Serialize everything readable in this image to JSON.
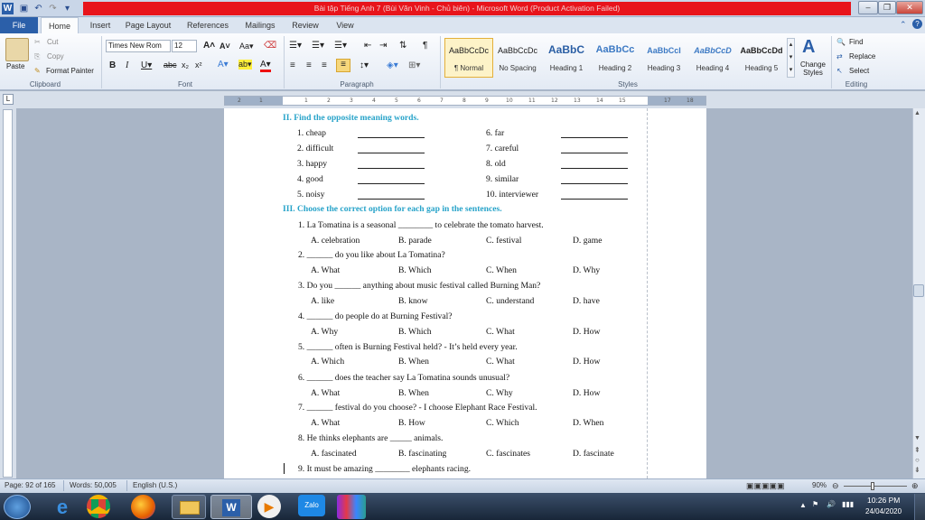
{
  "window": {
    "title": "Bài tập Tiếng Anh 7 (Bùi Văn Vinh - Chủ biên) - Microsoft Word (Product Activation Failed)"
  },
  "tabs": [
    "File",
    "Home",
    "Insert",
    "Page Layout",
    "References",
    "Mailings",
    "Review",
    "View"
  ],
  "clipboard": {
    "paste": "Paste",
    "cut": "Cut",
    "copy": "Copy",
    "format_painter": "Format Painter",
    "label": "Clipboard"
  },
  "font": {
    "name": "Times New Rom",
    "size": "12",
    "label": "Font"
  },
  "paragraph": {
    "label": "Paragraph"
  },
  "styles": {
    "label": "Styles",
    "items": [
      {
        "preview": "AaBbCcDc",
        "name": "¶ Normal"
      },
      {
        "preview": "AaBbCcDc",
        "name": "No Spacing"
      },
      {
        "preview": "AaBbC",
        "name": "Heading 1"
      },
      {
        "preview": "AaBbCc",
        "name": "Heading 2"
      },
      {
        "preview": "AaBbCcI",
        "name": "Heading 3"
      },
      {
        "preview": "AaBbCcD",
        "name": "Heading 4"
      },
      {
        "preview": "AaBbCcDd",
        "name": "Heading 5"
      }
    ],
    "change_styles": "Change Styles"
  },
  "editing": {
    "find": "Find",
    "replace": "Replace",
    "select": "Select",
    "label": "Editing"
  },
  "document": {
    "section2_title": "II.  Find the opposite meaning words.",
    "left_words": [
      "1. cheap",
      "2. difficult",
      "3. happy",
      "4. good",
      "5. noisy"
    ],
    "right_words": [
      "6. far",
      "7. careful",
      "8. old",
      "9. similar",
      "10. interviewer"
    ],
    "section3_title": "III. Choose the correct option for each gap in the sentences.",
    "questions": [
      {
        "q": "1.   La Tomatina is a seasonal ________ to celebrate the tomato harvest.",
        "a": "A. celebration",
        "b": "B. parade",
        "c": "C. festival",
        "d": "D. game"
      },
      {
        "q": "2.   ______ do you like about La Tomatina?",
        "a": "A. What",
        "b": "B. Which",
        "c": "C. When",
        "d": "D. Why"
      },
      {
        "q": "3.   Do you ______ anything about music festival called Burning Man?",
        "a": "A. like",
        "b": "B. know",
        "c": "C. understand",
        "d": "D. have"
      },
      {
        "q": "4.   ______ do people do at Burning Festival?",
        "a": "A. Why",
        "b": "B. Which",
        "c": "C. What",
        "d": "D. How"
      },
      {
        "q": "5.   ______ often is Burning Festival held? - It’s held every year.",
        "a": "A. Which",
        "b": "B. When",
        "c": "C. What",
        "d": "D. How"
      },
      {
        "q": "6.   ______ does the teacher say La Tomatina sounds unusual?",
        "a": "A. What",
        "b": "B. When",
        "c": "C. Why",
        "d": "D. How"
      },
      {
        "q": "7.   ______ festival do you choose? - I choose Elephant Race Festival.",
        "a": "A. What",
        "b": "B. How",
        "c": "C. Which",
        "d": "D. When"
      },
      {
        "q": "8.   He thinks elephants are _____ animals.",
        "a": "A. fascinated",
        "b": "B. fascinating",
        "c": "C. fascinates",
        "d": "D. fascinate"
      }
    ],
    "last_line": "9.   It must be amazing ________ elephants racing."
  },
  "status": {
    "page": "Page: 92 of 165",
    "words": "Words: 50,005",
    "language": "English (U.S.)",
    "zoom": "90%"
  },
  "clock": {
    "time": "10:26 PM",
    "date": "24/04/2020"
  },
  "colors": {
    "heading": "#27a3c9",
    "title_bar": "#e8141b",
    "file_tab": "#2b5fa9"
  }
}
